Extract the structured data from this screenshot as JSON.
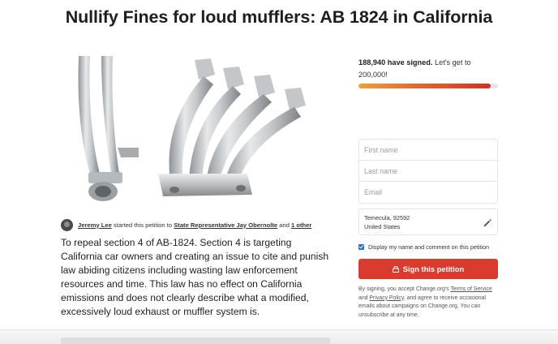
{
  "page": {
    "title": "Nullify Fines for loud mufflers: AB 1824 in California"
  },
  "author": {
    "name": "Jeremy Lee",
    "started_text": "started this petition to",
    "target": "State Representative Jay Obernolte",
    "and_text": "and",
    "others": "1 other"
  },
  "description": "To repeal section 4 of AB-1824. Section 4 is targeting California car owners and creating an issue to cite and punish law abiding citizens including wasting law enforcement resources and time. This law has no effect on California emissions and does not clearly describe what a modified, excessively loud exhaust or muffler system is.",
  "progress": {
    "signed": "188,940 have signed.",
    "goal_text": "Let's get to 200,000!",
    "fraction": 0.945
  },
  "form": {
    "first_name_placeholder": "First name",
    "last_name_placeholder": "Last name",
    "email_placeholder": "Email",
    "location_line1": "Temecula, 92592",
    "location_line2": "United States",
    "display_checkbox_label": "Display my name and comment on this petition",
    "sign_button": "Sign this petition"
  },
  "legal": {
    "prefix": "By signing, you accept Change.org's",
    "terms": "Terms of Service",
    "and": "and",
    "privacy": "Privacy Policy",
    "suffix": ", and agree to receive occasional emails about campaigns on Change.org. You can unsubscribe at any time."
  },
  "icons": {
    "edit": "pencil-icon",
    "lock": "lock-icon",
    "check": "checkbox-check-icon"
  },
  "colors": {
    "accent": "#db3a2f",
    "progress_start": "#f0a033",
    "progress_end": "#dc2c24",
    "checkbox": "#2f6fd1"
  }
}
